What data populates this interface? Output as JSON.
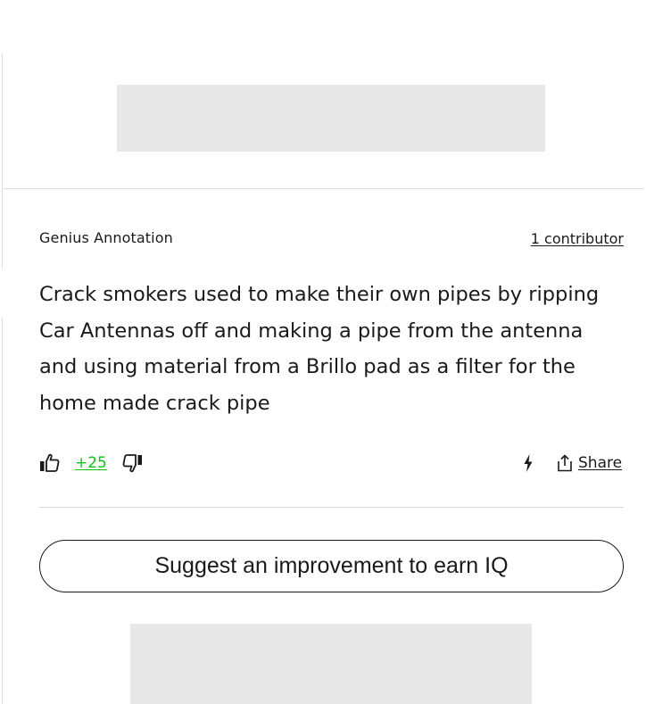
{
  "annotation": {
    "label": "Genius Annotation",
    "contributors_link": "1 contributor",
    "body": "Crack smokers used to make their own pipes by ripping Car Antennas off and making a pipe from the antenna and using material from a Brillo pad as a filter for the home made crack pipe"
  },
  "actions": {
    "upvote_icon": "thumbs-up-icon",
    "vote_count": "+25",
    "downvote_icon": "thumbs-down-icon",
    "bolt_icon": "lightning-bolt-icon",
    "share_icon": "share-icon",
    "share_label": "Share"
  },
  "suggest": {
    "label": "Suggest an improvement to earn IQ"
  },
  "colors": {
    "text": "#1a1a1a",
    "vote_positive": "#0ec316",
    "ad_placeholder": "#e8e8e8",
    "divider": "#e0e0e0"
  }
}
